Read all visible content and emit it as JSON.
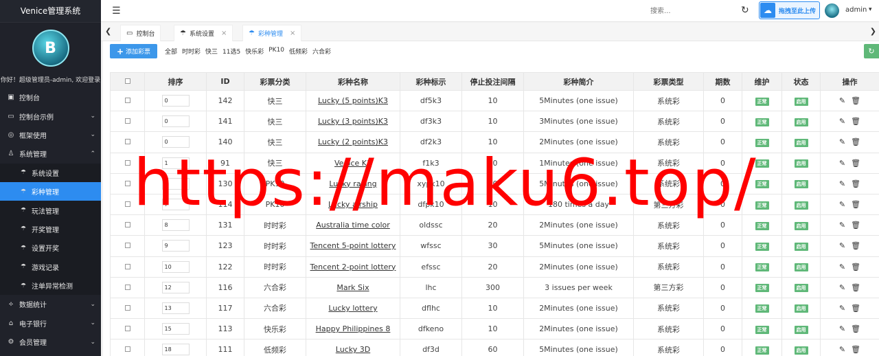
{
  "app": {
    "title": "Venice管理系统",
    "welcome": "你好！超级管理员-admin, 欢迎登录"
  },
  "sidebar": {
    "items": [
      {
        "label": "控制台",
        "icon": "dashboard-icon",
        "level": 1
      },
      {
        "label": "控制台示例",
        "icon": "monitor-icon",
        "level": 1,
        "caret": "⌄"
      },
      {
        "label": "框架使用",
        "icon": "settings-icon",
        "level": 1,
        "caret": "⌄"
      },
      {
        "label": "系统管理",
        "icon": "user-icon",
        "level": 1,
        "caret": "⌃"
      },
      {
        "label": "系统设置",
        "icon": "umbrella-icon",
        "level": 2
      },
      {
        "label": "彩种管理",
        "icon": "umbrella-icon",
        "level": 2,
        "active": true
      },
      {
        "label": "玩法管理",
        "icon": "umbrella-icon",
        "level": 2
      },
      {
        "label": "开奖管理",
        "icon": "umbrella-icon",
        "level": 2
      },
      {
        "label": "设置开奖",
        "icon": "umbrella-icon",
        "level": 2
      },
      {
        "label": "游戏记录",
        "icon": "umbrella-icon",
        "level": 2
      },
      {
        "label": "注单异常检测",
        "icon": "umbrella-icon",
        "level": 2
      },
      {
        "label": "数据统计",
        "icon": "chart-icon",
        "level": 1,
        "caret": "⌄"
      },
      {
        "label": "电子银行",
        "icon": "bank-icon",
        "level": 1,
        "caret": "⌄"
      },
      {
        "label": "会员管理",
        "icon": "gear-icon",
        "level": 1,
        "caret": "⌄"
      }
    ]
  },
  "header": {
    "search_placeholder": "搜索...",
    "upload_label": "拖拽至此上传",
    "user": "admin"
  },
  "tabs": [
    {
      "label": "控制台",
      "icon": "monitor-icon",
      "closable": false
    },
    {
      "label": "系统设置",
      "icon": "umbrella-icon",
      "closable": true
    },
    {
      "label": "彩种管理",
      "icon": "umbrella-icon",
      "closable": true,
      "active": true
    }
  ],
  "toolbar": {
    "add_label": "添加彩票",
    "filters": [
      "全部",
      "时时彩",
      "快三",
      "11选5",
      "快乐彩",
      "PK10",
      "低频彩",
      "六合彩"
    ]
  },
  "table": {
    "headers": [
      "排序",
      "ID",
      "彩票分类",
      "彩种名称",
      "彩种标示",
      "停止投注间隔",
      "彩种简介",
      "彩票类型",
      "期数",
      "维护",
      "状态",
      "操作"
    ],
    "rows": [
      {
        "sort": "0",
        "id": "142",
        "category": "快三",
        "name": "Lucky (5 points)K3",
        "code": "df5k3",
        "interval": "10",
        "intro": "5Minutes (one issue)",
        "type": "系统彩",
        "issues": "0",
        "maint": "正常",
        "status": "启用"
      },
      {
        "sort": "0",
        "id": "141",
        "category": "快三",
        "name": "Lucky (3 points)K3",
        "code": "df3k3",
        "interval": "10",
        "intro": "3Minutes (one issue)",
        "type": "系统彩",
        "issues": "0",
        "maint": "正常",
        "status": "启用"
      },
      {
        "sort": "0",
        "id": "140",
        "category": "快三",
        "name": "Lucky (2 points)K3",
        "code": "df2k3",
        "interval": "10",
        "intro": "2Minutes (one issue)",
        "type": "系统彩",
        "issues": "0",
        "maint": "正常",
        "status": "启用"
      },
      {
        "sort": "1",
        "id": "91",
        "category": "快三",
        "name": "Venice K3",
        "code": "f1k3",
        "interval": "20",
        "intro": "1Minutes (one issue)",
        "type": "系统彩",
        "issues": "0",
        "maint": "正常",
        "status": "启用"
      },
      {
        "sort": "4",
        "id": "130",
        "category": "PK10",
        "name": "Lucky racing",
        "code": "xypk10",
        "interval": "10",
        "intro": "5Minutes (one issue)",
        "type": "系统彩",
        "issues": "0",
        "maint": "正常",
        "status": "启用"
      },
      {
        "sort": "7",
        "id": "114",
        "category": "PK10",
        "name": "Lucky airship",
        "code": "dfpk10",
        "interval": "10",
        "intro": "180 times a day",
        "type": "第三方彩",
        "issues": "0",
        "maint": "正常",
        "status": "启用"
      },
      {
        "sort": "8",
        "id": "131",
        "category": "时时彩",
        "name": "Australia time color",
        "code": "oldssc",
        "interval": "20",
        "intro": "2Minutes (one issue)",
        "type": "系统彩",
        "issues": "0",
        "maint": "正常",
        "status": "启用"
      },
      {
        "sort": "9",
        "id": "123",
        "category": "时时彩",
        "name": "Tencent 5-point lottery",
        "code": "wfssc",
        "interval": "30",
        "intro": "5Minutes (one issue)",
        "type": "系统彩",
        "issues": "0",
        "maint": "正常",
        "status": "启用"
      },
      {
        "sort": "10",
        "id": "122",
        "category": "时时彩",
        "name": "Tencent 2-point lottery",
        "code": "efssc",
        "interval": "20",
        "intro": "2Minutes (one issue)",
        "type": "系统彩",
        "issues": "0",
        "maint": "正常",
        "status": "启用"
      },
      {
        "sort": "12",
        "id": "116",
        "category": "六合彩",
        "name": "Mark Six",
        "code": "lhc",
        "interval": "300",
        "intro": "3 issues per week",
        "type": "第三方彩",
        "issues": "0",
        "maint": "正常",
        "status": "启用"
      },
      {
        "sort": "13",
        "id": "117",
        "category": "六合彩",
        "name": "Lucky lottery",
        "code": "dflhc",
        "interval": "10",
        "intro": "2Minutes (one issue)",
        "type": "系统彩",
        "issues": "0",
        "maint": "正常",
        "status": "启用"
      },
      {
        "sort": "15",
        "id": "113",
        "category": "快乐彩",
        "name": "Happy Philippines 8",
        "code": "dfkeno",
        "interval": "10",
        "intro": "2Minutes (one issue)",
        "type": "系统彩",
        "issues": "0",
        "maint": "正常",
        "status": "启用"
      },
      {
        "sort": "18",
        "id": "111",
        "category": "低频彩",
        "name": "Lucky 3D",
        "code": "df3d",
        "interval": "60",
        "intro": "5Minutes (one issue)",
        "type": "系统彩",
        "issues": "0",
        "maint": "正常",
        "status": "启用"
      }
    ]
  },
  "watermark": "https://maku6.top/",
  "colors": {
    "sidebar_bg": "#20222a",
    "active": "#2d8cf0",
    "badge": "#5fb878",
    "watermark": "#ff0000"
  }
}
